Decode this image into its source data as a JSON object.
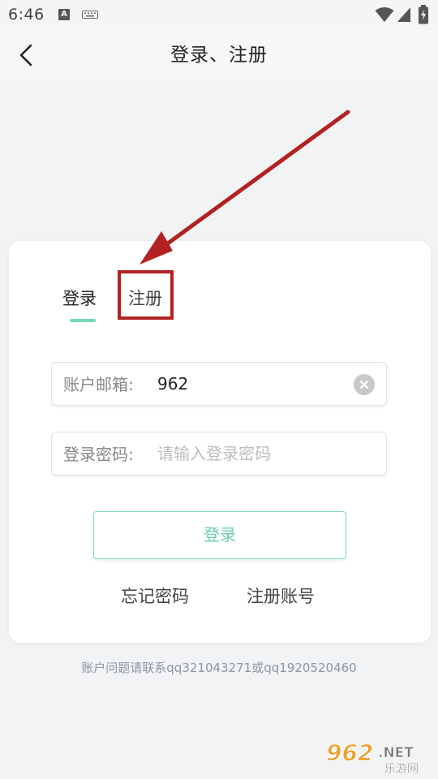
{
  "status_bar": {
    "time": "6:46",
    "a_badge": "A",
    "icons": [
      "a-notification-icon",
      "keyboard-icon",
      "wifi-icon",
      "signal-icon",
      "battery-icon"
    ]
  },
  "header": {
    "title": "登录、注册",
    "back_icon": "chevron-left-icon"
  },
  "tabs": {
    "login": "登录",
    "register": "注册",
    "active": "login"
  },
  "form": {
    "email_label": "账户邮箱:",
    "email_value": "962",
    "password_label": "登录密码:",
    "password_placeholder": "请输入登录密码",
    "clear_icon": "clear-icon",
    "login_button": "登录",
    "forgot_link": "忘记密码",
    "register_link": "注册账号"
  },
  "footer": {
    "contact_note": "账户问题请联系qq321043271或qq1920520460"
  },
  "watermark": {
    "logo_text": "962.NET",
    "sub_text": "乐游网"
  },
  "colors": {
    "accent": "#6fdcb7",
    "annotation_red": "#b32222",
    "background": "#f2f3f5"
  }
}
